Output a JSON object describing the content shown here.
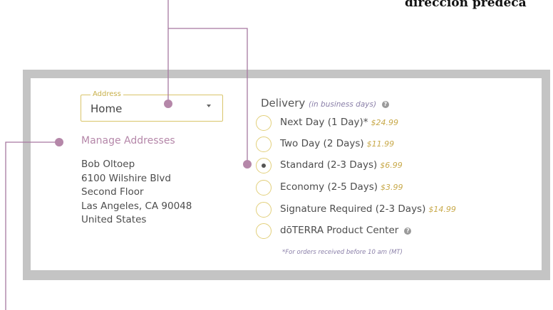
{
  "heading_fragment": "dirección predeca",
  "address": {
    "legend": "Address",
    "value": "Home",
    "manage_link": "Manage Addresses",
    "lines": [
      "Bob Oltoep",
      "6100 Wilshire Blvd",
      "Second Floor",
      "Las Angeles, CA 90048",
      "United States"
    ]
  },
  "delivery": {
    "title": "Delivery",
    "subtitle": "(in business days)",
    "options": [
      {
        "label": "Next Day (1 Day)*",
        "price": "$24.99",
        "checked": false
      },
      {
        "label": "Two Day (2 Days)",
        "price": "$11.99",
        "checked": false
      },
      {
        "label": "Standard (2-3 Days)",
        "price": "$6.99",
        "checked": true
      },
      {
        "label": "Economy (2-5 Days)",
        "price": "$3.99",
        "checked": false
      },
      {
        "label": "Signature Required (2-3 Days)",
        "price": "$14.99",
        "checked": false
      },
      {
        "label": "dōTERRA Product Center",
        "price": "",
        "checked": false,
        "help": true
      }
    ],
    "footnote": "*For orders received before 10 am (MT)"
  },
  "colors": {
    "accent_gold": "#e2cf7a",
    "link_mauve": "#b587a9",
    "callout_line": "#a678a0"
  }
}
